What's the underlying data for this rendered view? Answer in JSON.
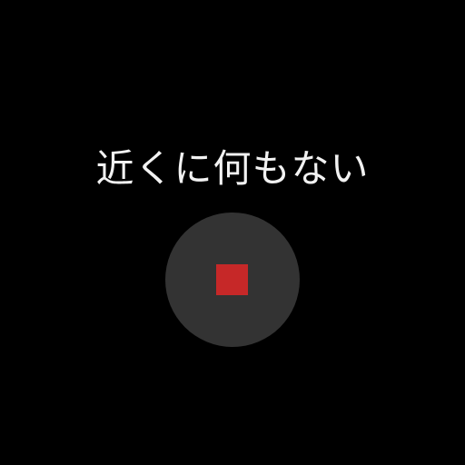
{
  "status": {
    "message": "近くに何もない"
  },
  "controls": {
    "stop_button": {
      "icon": "stop-icon",
      "background_color": "#333333",
      "icon_color": "#c62828"
    }
  }
}
